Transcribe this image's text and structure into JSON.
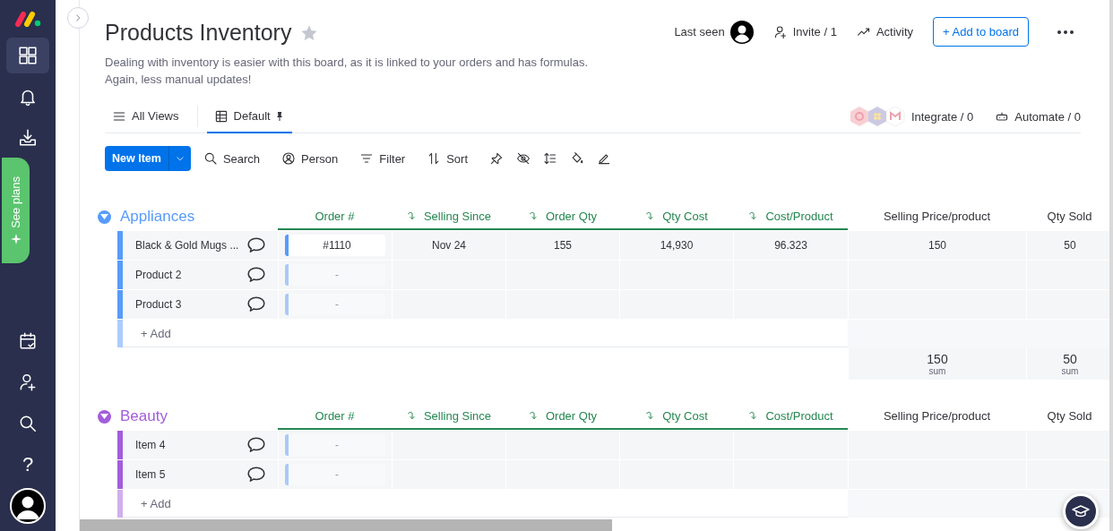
{
  "sidebar": {
    "items": [
      {
        "kind": "boards",
        "selected": true
      },
      {
        "kind": "notifications",
        "selected": false
      },
      {
        "kind": "inbox",
        "selected": false
      }
    ],
    "promo": {
      "label": "See plans"
    },
    "bottom_items": [
      {
        "kind": "calendar"
      },
      {
        "kind": "invite"
      },
      {
        "kind": "search"
      },
      {
        "kind": "help",
        "glyph": "?"
      },
      {
        "kind": "avatar"
      }
    ]
  },
  "board": {
    "title": "Products Inventory",
    "starred": false,
    "description": [
      "Dealing with inventory is easier with this board, as it is linked to your orders and has formulas.",
      "Again, less manual updates!"
    ],
    "header_actions": {
      "last_seen": "Last seen",
      "invite": "Invite / 1",
      "activity": "Activity",
      "add_to_board": "+ Add to board"
    }
  },
  "views": {
    "tabs": [
      {
        "label": "All Views",
        "kind": "menu",
        "selected": false
      },
      {
        "label": "Default",
        "kind": "table",
        "selected": true
      }
    ],
    "integrate": "Integrate / 0",
    "automate": "Automate / 0"
  },
  "toolbar": {
    "new_item": "New Item",
    "tools": [
      {
        "label": "Search",
        "kind": "search"
      },
      {
        "label": "Person",
        "kind": "person"
      },
      {
        "label": "Filter",
        "kind": "filter"
      },
      {
        "label": "Sort",
        "kind": "sort"
      }
    ],
    "icons": [
      {
        "kind": "pin"
      },
      {
        "kind": "hide"
      },
      {
        "kind": "height"
      },
      {
        "kind": "color"
      },
      {
        "kind": "pen"
      }
    ]
  },
  "groups": [
    {
      "name": "Appliances",
      "color": "#579bfc",
      "columns": [
        {
          "label": "Order #",
          "kind": "link"
        },
        {
          "label": "Selling Since",
          "kind": "mirror"
        },
        {
          "label": "Order Qty",
          "kind": "mirror"
        },
        {
          "label": "Qty Cost",
          "kind": "mirror"
        },
        {
          "label": "Cost/Product",
          "kind": "mirror"
        },
        {
          "label": "Selling Price/product",
          "kind": "plain"
        },
        {
          "label": "Qty Sold",
          "kind": "plain"
        }
      ],
      "items": [
        {
          "name": "Black & Gold Mugs ...",
          "order_no": "#1110",
          "selling_since": "Nov 24",
          "order_qty": "155",
          "qty_cost": "14,930",
          "cost_per_product": "96.323",
          "selling_price_per_product": "150",
          "qty_sold": "50"
        },
        {
          "name": "Product 2",
          "order_no": "-"
        },
        {
          "name": "Product 3",
          "order_no": "-"
        }
      ],
      "add_label": "+ Add",
      "summary": {
        "selling_price_per_product": {
          "value": "150",
          "label": "sum"
        },
        "qty_sold": {
          "value": "50",
          "label": "sum"
        }
      }
    },
    {
      "name": "Beauty",
      "color": "#a25ddc",
      "columns": [
        {
          "label": "Order #",
          "kind": "link"
        },
        {
          "label": "Selling Since",
          "kind": "mirror"
        },
        {
          "label": "Order Qty",
          "kind": "mirror"
        },
        {
          "label": "Qty Cost",
          "kind": "mirror"
        },
        {
          "label": "Cost/Product",
          "kind": "mirror"
        },
        {
          "label": "Selling Price/product",
          "kind": "plain"
        },
        {
          "label": "Qty Sold",
          "kind": "plain"
        }
      ],
      "items": [
        {
          "name": "Item 4",
          "order_no": "-"
        },
        {
          "name": "Item 5",
          "order_no": "-"
        }
      ],
      "add_label": "+ Add"
    }
  ]
}
